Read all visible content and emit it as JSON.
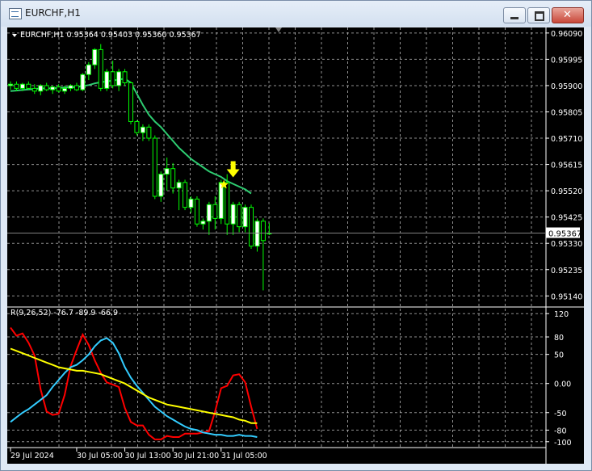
{
  "window": {
    "title": "EURCHF,H1",
    "min_icon": "minimize-icon",
    "max_icon": "maximize-icon",
    "close_icon": "close-icon",
    "close_glyph": "✕"
  },
  "colors": {
    "background": "#000000",
    "grid": "#c0c0c0",
    "bull": "#ffffff",
    "bear": "#000000",
    "candle_outline": "#00ff00",
    "ma": "#2ecc71",
    "axis_text": "#ffffff",
    "arrow": "#ffff00",
    "rsi_red": "#ff0000",
    "rsi_cyan": "#33ccff",
    "rsi_yellow": "#ffff00"
  },
  "chart_data": [
    {
      "type": "candlestick",
      "symbol": "EURCHF",
      "timeframe": "H1",
      "header": "EURCHF,H1  0.95364 0.95403 0.95360 0.95367",
      "title": "EURCHF,H1",
      "ohlc_label": "0.95364 0.95403 0.95360 0.95367",
      "ylim": [
        0.951,
        0.9611
      ],
      "y_ticks": [
        "0.96090",
        "0.95995",
        "0.95900",
        "0.95805",
        "0.95710",
        "0.95615",
        "0.95520",
        "0.95425",
        "0.95330",
        "0.95235",
        "0.95140"
      ],
      "y_tick_values": [
        0.9609,
        0.95995,
        0.959,
        0.95805,
        0.9571,
        0.95615,
        0.9552,
        0.95425,
        0.9533,
        0.95235,
        0.9514
      ],
      "current_price": "0.95367",
      "current_price_value": 0.95367,
      "candles": [
        [
          0.959,
          0.95915,
          0.95885,
          0.95905
        ],
        [
          0.95905,
          0.95915,
          0.9588,
          0.9589
        ],
        [
          0.9589,
          0.9591,
          0.9588,
          0.95905
        ],
        [
          0.95905,
          0.95915,
          0.95885,
          0.9589
        ],
        [
          0.9589,
          0.95905,
          0.9587,
          0.9588
        ],
        [
          0.9588,
          0.95905,
          0.95865,
          0.959
        ],
        [
          0.959,
          0.9591,
          0.9588,
          0.95885
        ],
        [
          0.95885,
          0.959,
          0.9587,
          0.95895
        ],
        [
          0.95895,
          0.95905,
          0.95875,
          0.9588
        ],
        [
          0.9588,
          0.959,
          0.9587,
          0.9589
        ],
        [
          0.9589,
          0.95905,
          0.9588,
          0.959
        ],
        [
          0.959,
          0.9591,
          0.9588,
          0.95885
        ],
        [
          0.95885,
          0.95945,
          0.9588,
          0.9594
        ],
        [
          0.9594,
          0.95985,
          0.9592,
          0.95975
        ],
        [
          0.95975,
          0.96035,
          0.9596,
          0.9603
        ],
        [
          0.9603,
          0.9605,
          0.9588,
          0.9589
        ],
        [
          0.9589,
          0.9596,
          0.9588,
          0.9595
        ],
        [
          0.9595,
          0.9599,
          0.9589,
          0.959
        ],
        [
          0.959,
          0.9596,
          0.9588,
          0.9595
        ],
        [
          0.9595,
          0.9596,
          0.959,
          0.9591
        ],
        [
          0.9591,
          0.95915,
          0.9576,
          0.9577
        ],
        [
          0.9577,
          0.95775,
          0.9572,
          0.9573
        ],
        [
          0.9573,
          0.9576,
          0.957,
          0.9575
        ],
        [
          0.9575,
          0.9576,
          0.957,
          0.9571
        ],
        [
          0.9571,
          0.9572,
          0.9549,
          0.955
        ],
        [
          0.955,
          0.9559,
          0.9548,
          0.9558
        ],
        [
          0.9558,
          0.9564,
          0.9552,
          0.956
        ],
        [
          0.956,
          0.9562,
          0.9551,
          0.9553
        ],
        [
          0.9553,
          0.9556,
          0.9545,
          0.9555
        ],
        [
          0.9555,
          0.9556,
          0.9545,
          0.9546
        ],
        [
          0.9546,
          0.955,
          0.9544,
          0.9549
        ],
        [
          0.9549,
          0.955,
          0.9539,
          0.954
        ],
        [
          0.954,
          0.9542,
          0.9538,
          0.9541
        ],
        [
          0.9541,
          0.9548,
          0.9536,
          0.9547
        ],
        [
          0.9547,
          0.955,
          0.9538,
          0.9542
        ],
        [
          0.9542,
          0.9556,
          0.954,
          0.9555
        ],
        [
          0.9555,
          0.9558,
          0.9536,
          0.954
        ],
        [
          0.954,
          0.9548,
          0.9536,
          0.9547
        ],
        [
          0.9547,
          0.9548,
          0.9537,
          0.9539
        ],
        [
          0.9539,
          0.9547,
          0.9537,
          0.9546
        ],
        [
          0.9546,
          0.9547,
          0.9531,
          0.9532
        ],
        [
          0.9532,
          0.9542,
          0.953,
          0.9541
        ],
        [
          0.9541,
          0.9542,
          0.9516,
          0.9534
        ],
        [
          0.95364,
          0.95403,
          0.9536,
          0.95367
        ]
      ],
      "ma": [
        0.9588,
        0.95882,
        0.95884,
        0.95886,
        0.95888,
        0.9589,
        0.9589,
        0.9589,
        0.95892,
        0.95893,
        0.95894,
        0.95895,
        0.95898,
        0.95902,
        0.95908,
        0.95912,
        0.95915,
        0.95918,
        0.95922,
        0.95925,
        0.9591,
        0.9587,
        0.9583,
        0.95795,
        0.9577,
        0.9575,
        0.95725,
        0.957,
        0.95675,
        0.95655,
        0.95635,
        0.9562,
        0.95605,
        0.9559,
        0.9558,
        0.9557,
        0.95555,
        0.95545,
        0.95535,
        0.95525,
        0.9551
      ],
      "arrow_bar": 37,
      "star_bar": 36,
      "x_labels": [
        "29 Jul 2024",
        "30 Jul 05:00",
        "30 Jul 13:00",
        "30 Jul 21:00",
        "31 Jul 05:00"
      ],
      "x_label_bars": [
        0,
        11,
        19,
        27,
        35
      ]
    },
    {
      "type": "line",
      "header": "R(9,26,52) -76.7 -89.9 -66.9",
      "ylim": [
        -110,
        130
      ],
      "y_ticks": [
        "120",
        "80",
        "50",
        "0.00",
        "-50",
        "-80",
        "-100"
      ],
      "y_tick_values": [
        120,
        80,
        50,
        0,
        -50,
        -80,
        -100
      ],
      "series": [
        {
          "color": "red",
          "values": [
            96,
            82,
            86,
            70,
            48,
            -10,
            -48,
            -54,
            -52,
            -20,
            30,
            58,
            84,
            66,
            40,
            18,
            2,
            -2,
            -6,
            -42,
            -66,
            -72,
            -72,
            -88,
            -96,
            -96,
            -90,
            -92,
            -92,
            -86,
            -86,
            -86,
            -84,
            -82,
            -48,
            -8,
            -4,
            14,
            16,
            2,
            -40,
            -78
          ]
        },
        {
          "color": "cyan",
          "values": [
            -66,
            -58,
            -50,
            -44,
            -36,
            -28,
            -20,
            -6,
            6,
            18,
            28,
            32,
            40,
            50,
            64,
            74,
            78,
            70,
            52,
            28,
            10,
            -4,
            -16,
            -28,
            -40,
            -48,
            -56,
            -62,
            -68,
            -74,
            -78,
            -80,
            -84,
            -86,
            -88,
            -88,
            -90,
            -90,
            -88,
            -90,
            -90,
            -92
          ]
        },
        {
          "color": "yellow",
          "values": [
            60,
            56,
            52,
            48,
            44,
            40,
            36,
            32,
            28,
            26,
            24,
            22,
            22,
            20,
            18,
            16,
            12,
            8,
            4,
            0,
            -6,
            -12,
            -18,
            -24,
            -28,
            -32,
            -36,
            -38,
            -40,
            -42,
            -44,
            -46,
            -48,
            -50,
            -52,
            -54,
            -56,
            -58,
            -62,
            -64,
            -68,
            -68
          ]
        }
      ]
    }
  ]
}
